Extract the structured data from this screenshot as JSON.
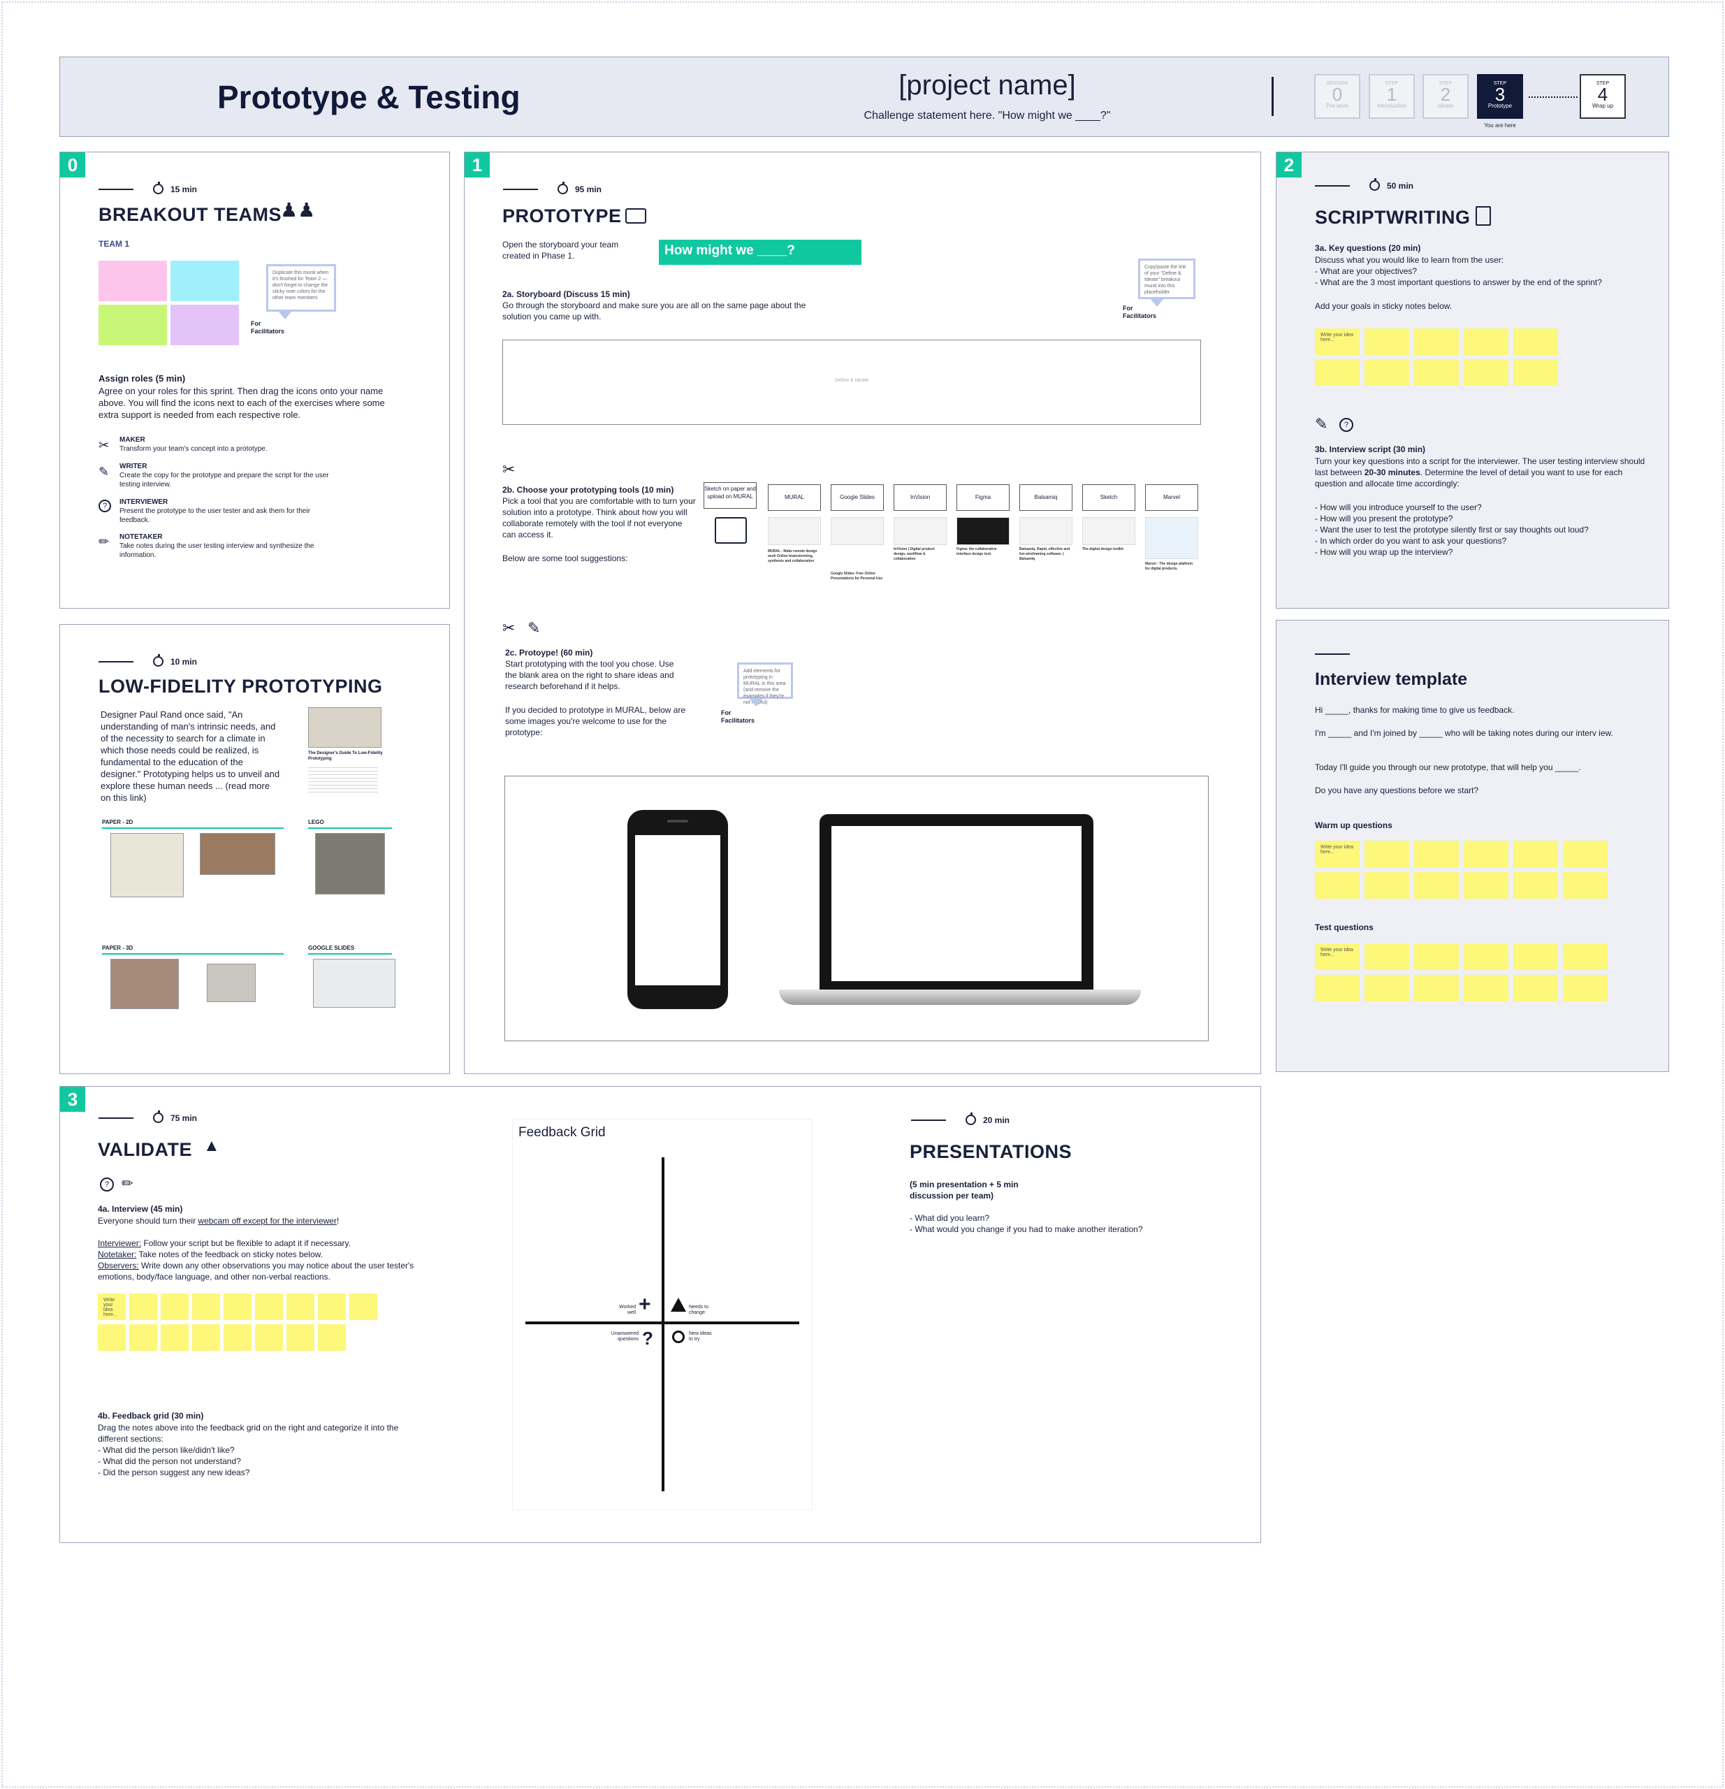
{
  "header": {
    "title": "Prototype & Testing",
    "project": "[project name]",
    "challenge": "Challenge statement here. \"How might we ____?\"",
    "steps": [
      {
        "label": "SESSION",
        "num": "0",
        "name": "Pre-work"
      },
      {
        "label": "STEP",
        "num": "1",
        "name": "Introduction"
      },
      {
        "label": "STEP",
        "num": "2",
        "name": "Ideate"
      },
      {
        "label": "STEP",
        "num": "3",
        "name": "Prototype"
      },
      {
        "label": "STEP",
        "num": "4",
        "name": "Wrap up"
      }
    ],
    "you_are_here": "You are here"
  },
  "breakout": {
    "badge": "0",
    "time": "15 min",
    "title": "BREAKOUT TEAMS",
    "team": "TEAM 1",
    "bubble": "Duplicate this mural when it's finished for Team 2 — don't forget to change the sticky note colors for the other team members",
    "for_facilitators": "For Facilitators",
    "assign_title": "Assign roles (5 min)",
    "assign_body": "Agree on your roles for this sprint. Then drag the icons onto your name above. You will find the icons next to each of the exercises where some extra support is needed from each respective role.",
    "roles": [
      {
        "name": "MAKER",
        "desc": "Transform your team's concept into a prototype.",
        "icon": "scissors-icon"
      },
      {
        "name": "WRITER",
        "desc": "Create the copy for the prototype and prepare the script for the user testing interview.",
        "icon": "edit-icon"
      },
      {
        "name": "INTERVIEWER",
        "desc": "Present the prototype to the user tester and ask them for their feedback.",
        "icon": "question-icon"
      },
      {
        "name": "NOTETAKER",
        "desc": "Take notes during the user testing interview and synthesize the information.",
        "icon": "note-icon"
      }
    ]
  },
  "lowfi": {
    "time": "10 min",
    "title": "LOW-FIDELITY PROTOTYPING",
    "body": "Designer Paul Rand once said, \"An understanding of man's intrinsic needs, and of the necessity to search for a climate in which those needs could be realized, is fundamental to the education of the designer.\" Prototyping helps us to unveil and explore these human needs ... (read more on this link)",
    "article_title": "The Designer's Guide To Low-Fidelity Prototyping",
    "sections": [
      "PAPER - 2D",
      "LEGO",
      "PAPER - 3D",
      "GOOGLE SLIDES"
    ]
  },
  "prototype": {
    "badge": "1",
    "time": "95 min",
    "title": "PROTOTYPE",
    "intro": "Open the storyboard your team created in Phase 1.",
    "hmw": "How might we ____?",
    "bubble": "Copy/paste the link of your \"Define & Ideate\" breakout mural into this placeholder",
    "for_facilitators": "For Facilitators",
    "s2a_title": "2a. Storyboard (Discuss 15 min)",
    "s2a_body": "Go through the storyboard and make sure you are all on the same page about the solution you came up with.",
    "placeholder": "Define & Ideate",
    "s2b_title": "2b. Choose your prototyping tools (10 min)",
    "s2b_body": "Pick a tool that you are comfortable with to turn your solution into a prototype. Think about how you will collaborate remotely with the tool if not everyone can access it.",
    "s2b_body2": "Below are some tool suggestions:",
    "tools": [
      "Sketch on paper and upload on MURAL",
      "MURAL",
      "Google Slides",
      "InVision",
      "Figma",
      "Balsamiq",
      "Sketch",
      "Marvel"
    ],
    "tool_captions": [
      "",
      "MURAL - Make remote design work Online brainstorming, synthesis and collaboration",
      "Google Slides: Free Online Presentations for Personal Use",
      "InVision | Digital product design, workflow & collaboration",
      "Figma: the collaborative interface design tool.",
      "Balsamiq. Rapid, effective and fun wireframing software. | Balsamiq",
      "The digital design toolkit",
      "Marvel - The design platform for digital products."
    ],
    "s2c_title": "2c. Protoype! (60 min)",
    "s2c_body": "Start prototyping with the tool you chose. Use the blank area on the right to share ideas and research beforehand if it helps.",
    "s2c_body2": "If you decided to prototype in MURAL, below are some images you're welcome to use for the prototype:",
    "bubble2": "Add elements for prototyping in MURAL in this area (and remove the examples if they're not helpful)",
    "for_facilitators2": "For Facilitators"
  },
  "scriptwriting": {
    "badge": "2",
    "time": "50 min",
    "title": "SCRIPTWRITING",
    "s3a_title": "3a. Key questions (20 min)",
    "s3a_lines": [
      "Discuss what you would like to learn from the user:",
      "- What are your objectives?",
      "- What are the 3 most important questions to answer by the end of the sprint?"
    ],
    "s3a_goals": "Add your goals in sticky notes below.",
    "sticky_hint": "Write your idea here...",
    "s3b_title": "3b. Interview script (30 min)",
    "s3b_body_pre": "Turn your key questions into a script for the interviewer. The user testing interview should last between ",
    "s3b_bold": "20-30 minutes",
    "s3b_body_post": ". Determine the level of detail you want to use for each question and allocate time accordingly:",
    "s3b_list": [
      "- How will you introduce yourself to the user?",
      "- How will you present the prototype?",
      "- Want the user to test the prototype silently first or say thoughts out loud?",
      "- In which order do you want to ask your questions?",
      "- How will you wrap up the interview?"
    ]
  },
  "interview": {
    "title": "Interview template",
    "lines": [
      "Hi _____, thanks for making time to give us feedback.",
      "I'm _____ and I'm joined by _____ who will be taking notes during our interv iew.",
      "Today I'll guide you through our new prototype, that will help you _____.",
      "Do you have any questions before we start?"
    ],
    "warmup": "Warm up questions",
    "test": "Test questions",
    "sticky_hint": "Write your idea here..."
  },
  "validate": {
    "badge": "3",
    "time": "75 min",
    "title": "VALIDATE",
    "s4a_title": "4a. Interview (45 min)",
    "s4a_pre": "Everyone should turn their ",
    "s4a_link": "webcam off except for the interviewer",
    "s4a_post": "!",
    "roles": [
      {
        "label": "Interviewer:",
        "text": " Follow your script but be flexible to adapt it if necessary."
      },
      {
        "label": "Notetaker:",
        "text": " Take notes of the feedback on sticky notes below."
      },
      {
        "label": "Observers:",
        "text": " Write down any other observations you may notice about the user tester's emotions, body/face language, and other non-verbal reactions."
      }
    ],
    "sticky_hint": "Write your idea here...",
    "s4b_title": "4b. Feedback grid (30 min)",
    "s4b_lines": [
      "Drag the notes above into the feedback grid on the right and categorize it into the different sections:",
      "- What did the person like/didn't like?",
      "- What did the person not understand?",
      "- Did the person suggest any new ideas?"
    ]
  },
  "feedback_grid": {
    "title": "Feedback Grid",
    "q1": "Worked well",
    "q2": "Needs to change",
    "q3": "Unanswered questions",
    "q4": "New ideas to try"
  },
  "presentations": {
    "time": "20 min",
    "title": "PRESENTATIONS",
    "subtitle": "(5 min presentation + 5 min discussion per team)",
    "lines": [
      "- What did you learn?",
      "- What would you change if you had to make another iteration?"
    ]
  },
  "colors": {
    "accent": "#10c8a0",
    "navy": "#121a3a",
    "sticky_yellow": "#fdf77a",
    "sticky_pink": "#fdc5ec",
    "sticky_cyan": "#9ff0fb",
    "sticky_green": "#c8f777",
    "sticky_purple": "#e3c3f7"
  }
}
